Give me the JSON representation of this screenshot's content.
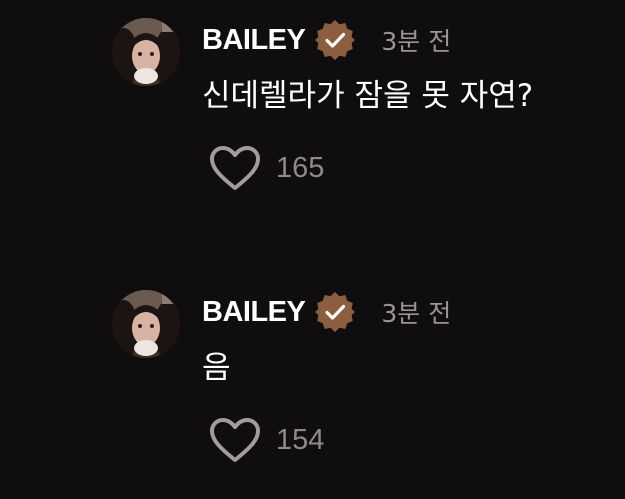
{
  "colors": {
    "background": "#0f0d0d",
    "badge": "#8a5e3f",
    "muted_text": "#9a9593",
    "heart_outline": "#a19c9a"
  },
  "comments": [
    {
      "username": "BAILEY",
      "verified_icon": "verified-badge-icon",
      "time": "3분 전",
      "text": "신데렐라가 잠을 못 자연?",
      "like_icon": "heart-outline-icon",
      "like_count": "165"
    },
    {
      "username": "BAILEY",
      "verified_icon": "verified-badge-icon",
      "time": "3분 전",
      "text": "음",
      "like_icon": "heart-outline-icon",
      "like_count": "154"
    }
  ]
}
